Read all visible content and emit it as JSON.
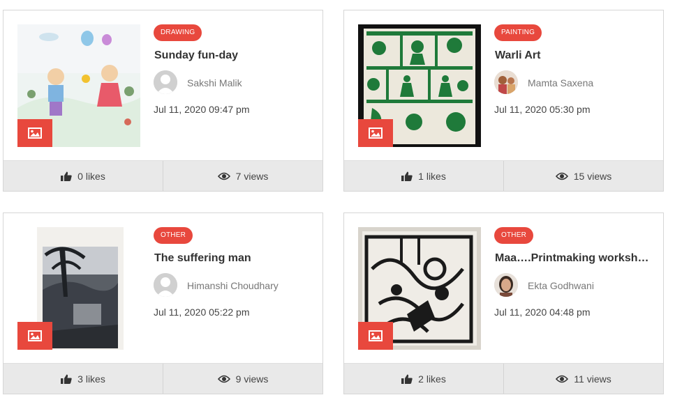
{
  "posts": [
    {
      "category": "DRAWING",
      "title": "Sunday fun-day",
      "author": "Sakshi Malik",
      "date": "Jul 11, 2020 09:47 pm",
      "likes": "0 likes",
      "views": "7 views",
      "avatar": "default-avatar-icon"
    },
    {
      "category": "PAINTING",
      "title": "Warli Art",
      "author": "Mamta Saxena",
      "date": "Jul 11, 2020 05:30 pm",
      "likes": "1 likes",
      "views": "15 views",
      "avatar": "user-photo"
    },
    {
      "category": "OTHER",
      "title": "The suffering man",
      "author": "Himanshi Choudhary",
      "date": "Jul 11, 2020 05:22 pm",
      "likes": "3 likes",
      "views": "9 views",
      "avatar": "default-avatar-icon"
    },
    {
      "category": "OTHER",
      "title": "Maa….Printmaking worksh…",
      "author": "Ekta Godhwani",
      "date": "Jul 11, 2020 04:48 pm",
      "likes": "2 likes",
      "views": "11 views",
      "avatar": "user-photo"
    }
  ],
  "colors": {
    "accent": "#e8483d",
    "footer_bg": "#e9e9e9",
    "border": "#d6d6d6"
  },
  "icons": {
    "image_badge": "image-icon",
    "likes": "thumbs-up-icon",
    "views": "eye-icon"
  }
}
